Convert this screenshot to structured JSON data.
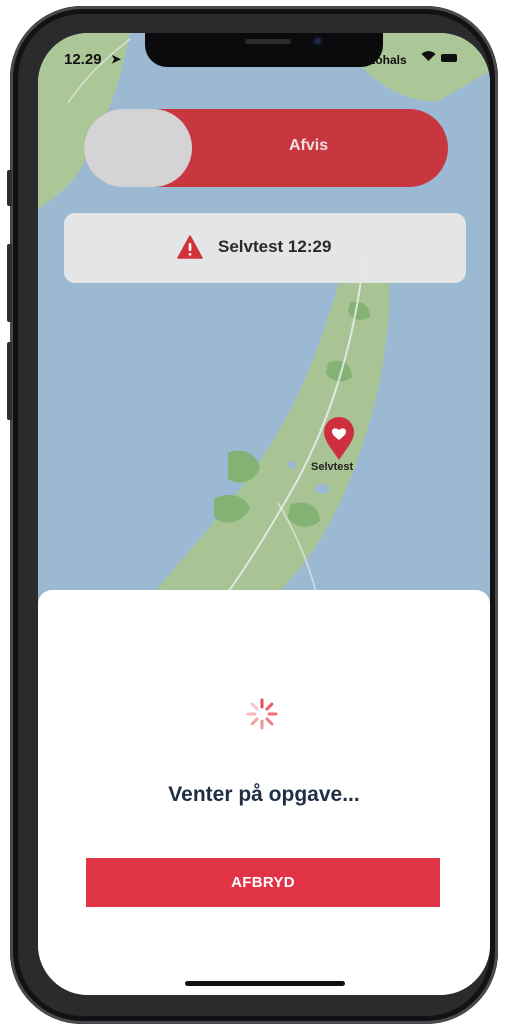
{
  "status_bar": {
    "time": "12.29",
    "location_icon": "location-arrow-icon",
    "carrier": "Lohals",
    "wifi_icon": "wifi-icon",
    "battery_icon": "battery-icon"
  },
  "slider": {
    "label": "Afvis",
    "color": "#c8363f"
  },
  "banner": {
    "icon": "warning-icon",
    "title": "Selvtest 12:29"
  },
  "map": {
    "pin_icon": "heart-pin-icon",
    "pin_label": "Selvtest"
  },
  "sheet": {
    "spinner_icon": "spinner-icon",
    "status_text": "Venter på opgave...",
    "cancel_label": "AFBRYD",
    "accent": "#e13446"
  }
}
